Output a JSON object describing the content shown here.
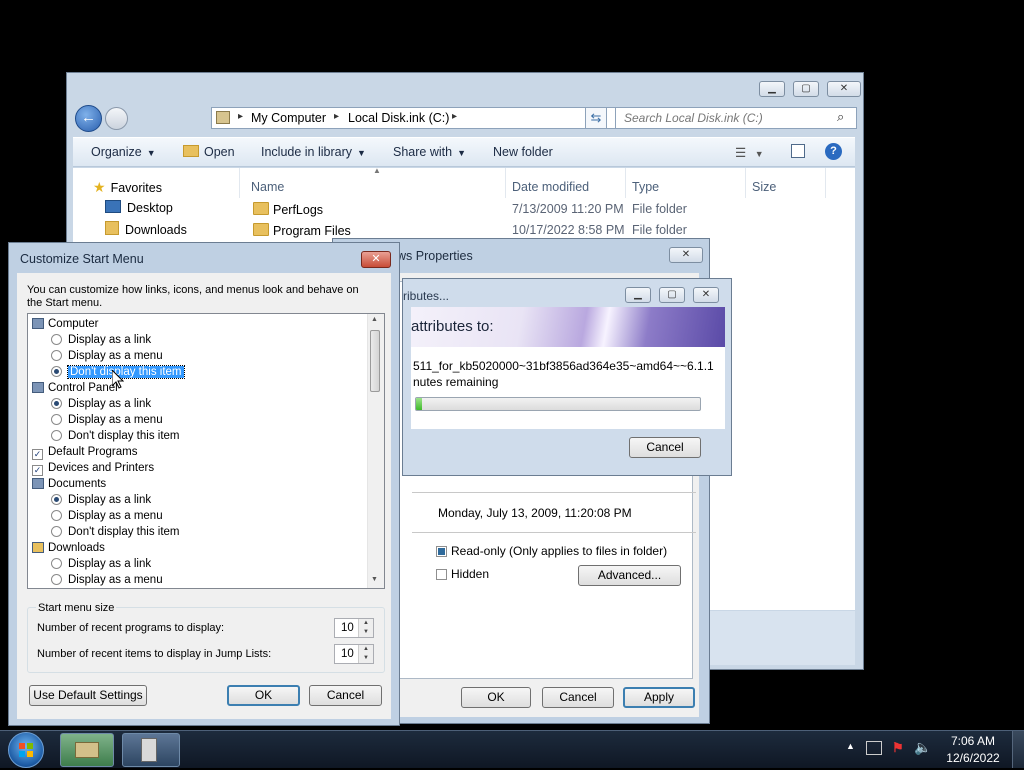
{
  "explorer": {
    "breadcrumb": [
      "My Computer",
      "Local Disk.ink (C:)"
    ],
    "search_placeholder": "Search Local Disk.ink (C:)",
    "toolbar": {
      "organize": "Organize",
      "open": "Open",
      "include_in_library": "Include in library",
      "share_with": "Share with",
      "new_folder": "New folder"
    },
    "nav": {
      "favorites": "Favorites",
      "desktop": "Desktop",
      "downloads": "Downloads"
    },
    "columns": {
      "name": "Name",
      "date_modified": "Date modified",
      "type": "Type",
      "size": "Size"
    },
    "files": [
      {
        "name": "PerfLogs",
        "date": "7/13/2009 11:20 PM",
        "type": "File folder"
      },
      {
        "name": "Program Files",
        "date": "10/17/2022 8:58 PM",
        "type": "File folder"
      }
    ]
  },
  "properties": {
    "title_fragment": "ws Properties",
    "created": "Monday, July 13, 2009, 11:20:08 PM",
    "readonly_label": "Read-only (Only applies to files in folder)",
    "hidden_label": "Hidden",
    "advanced": "Advanced...",
    "ok": "OK",
    "cancel": "Cancel",
    "apply": "Apply"
  },
  "progress_dialog": {
    "title_fragment": "ributes...",
    "heading": "attributes to:",
    "file": "511_for_kb5020000~31bf3856ad364e35~amd64~~6.1.1",
    "remaining": "nutes remaining",
    "progress_fraction": 0.02,
    "cancel": "Cancel"
  },
  "customize": {
    "title": "Customize Start Menu",
    "description": "You can customize how links, icons, and menus look and behave on the Start menu.",
    "items": [
      {
        "kind": "header",
        "label": "Computer",
        "icon": "computer-icon"
      },
      {
        "kind": "radio",
        "label": "Display as a link",
        "checked": false
      },
      {
        "kind": "radio",
        "label": "Display as a menu",
        "checked": false
      },
      {
        "kind": "radio",
        "label": "Don't display this item",
        "checked": true,
        "selected": true
      },
      {
        "kind": "header",
        "label": "Control Panel",
        "icon": "control-panel-icon"
      },
      {
        "kind": "radio",
        "label": "Display as a link",
        "checked": true
      },
      {
        "kind": "radio",
        "label": "Display as a menu",
        "checked": false
      },
      {
        "kind": "radio",
        "label": "Don't display this item",
        "checked": false
      },
      {
        "kind": "check",
        "label": "Default Programs",
        "checked": true
      },
      {
        "kind": "check",
        "label": "Devices and Printers",
        "checked": true
      },
      {
        "kind": "header",
        "label": "Documents",
        "icon": "documents-icon"
      },
      {
        "kind": "radio",
        "label": "Display as a link",
        "checked": true
      },
      {
        "kind": "radio",
        "label": "Display as a menu",
        "checked": false
      },
      {
        "kind": "radio",
        "label": "Don't display this item",
        "checked": false
      },
      {
        "kind": "header",
        "label": "Downloads",
        "icon": "downloads-icon"
      },
      {
        "kind": "radio",
        "label": "Display as a link",
        "checked": false
      },
      {
        "kind": "radio",
        "label": "Display as a menu",
        "checked": false
      }
    ],
    "size_group": "Start menu size",
    "recent_programs_label": "Number of recent programs to display:",
    "recent_programs_value": "10",
    "recent_items_label": "Number of recent items to display in Jump Lists:",
    "recent_items_value": "10",
    "default_settings": "Use Default Settings",
    "ok": "OK",
    "cancel": "Cancel"
  },
  "taskbar": {
    "time": "7:06 AM",
    "date": "12/6/2022"
  }
}
